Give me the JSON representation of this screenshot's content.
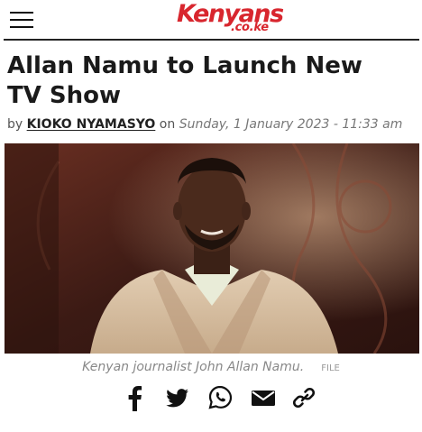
{
  "header": {
    "logo_brand": "Kenyans",
    "logo_tld": ".co.ke",
    "menu_icon": "hamburger-menu-icon"
  },
  "article": {
    "title": "Allan Namu to Launch New TV Show",
    "by_label": "by",
    "author": "KIOKO NYAMASYO",
    "on_label": "on",
    "date": "Sunday, 1 January 2023 - 11:33 am"
  },
  "image": {
    "caption": "Kenyan journalist John Allan Namu.",
    "source": "FILE"
  },
  "share": {
    "icons": [
      "facebook-icon",
      "twitter-icon",
      "whatsapp-icon",
      "email-icon",
      "link-icon"
    ]
  },
  "colors": {
    "brand_red": "#d8262e",
    "text": "#1a1a1a",
    "muted": "#888888"
  }
}
